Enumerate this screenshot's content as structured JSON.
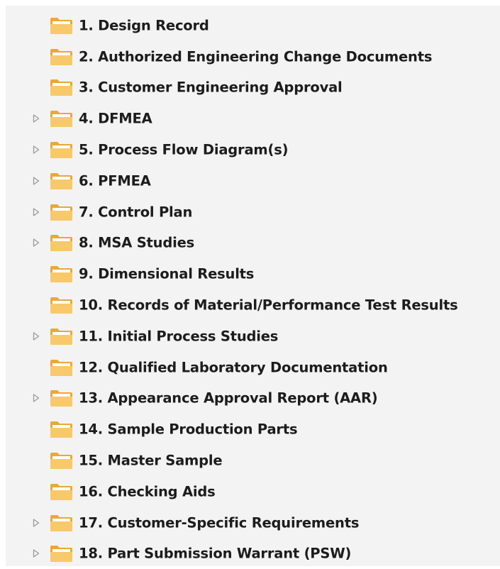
{
  "tree": {
    "items": [
      {
        "label": "1. Design Record",
        "expandable": false,
        "icon": "folder-icon"
      },
      {
        "label": "2. Authorized Engineering Change Documents",
        "expandable": false,
        "icon": "folder-icon"
      },
      {
        "label": "3. Customer Engineering Approval",
        "expandable": false,
        "icon": "folder-icon"
      },
      {
        "label": "4. DFMEA",
        "expandable": true,
        "icon": "folder-icon"
      },
      {
        "label": "5. Process Flow Diagram(s)",
        "expandable": true,
        "icon": "folder-icon"
      },
      {
        "label": "6. PFMEA",
        "expandable": true,
        "icon": "folder-icon"
      },
      {
        "label": "7. Control Plan",
        "expandable": true,
        "icon": "folder-icon"
      },
      {
        "label": "8. MSA Studies",
        "expandable": true,
        "icon": "folder-icon"
      },
      {
        "label": "9. Dimensional Results",
        "expandable": false,
        "icon": "folder-icon"
      },
      {
        "label": "10. Records of Material/Performance Test Results",
        "expandable": false,
        "icon": "folder-icon"
      },
      {
        "label": "11. Initial Process Studies",
        "expandable": true,
        "icon": "folder-icon"
      },
      {
        "label": "12. Qualified Laboratory Documentation",
        "expandable": false,
        "icon": "folder-icon"
      },
      {
        "label": "13. Appearance Approval Report (AAR)",
        "expandable": true,
        "icon": "folder-icon"
      },
      {
        "label": "14. Sample Production Parts",
        "expandable": false,
        "icon": "folder-icon"
      },
      {
        "label": "15. Master Sample",
        "expandable": false,
        "icon": "folder-icon"
      },
      {
        "label": "16. Checking Aids",
        "expandable": false,
        "icon": "folder-icon"
      },
      {
        "label": "17. Customer-Specific Requirements",
        "expandable": true,
        "icon": "folder-icon"
      },
      {
        "label": "18. Part Submission Warrant (PSW)",
        "expandable": true,
        "icon": "folder-icon"
      }
    ]
  },
  "colors": {
    "panel_background": "#f3f3f3",
    "folder_back": "#e8a93a",
    "folder_front": "#f7c96a",
    "folder_paper": "#ffffff",
    "expander": "#9a9a9a",
    "text": "#1c1c1c"
  }
}
